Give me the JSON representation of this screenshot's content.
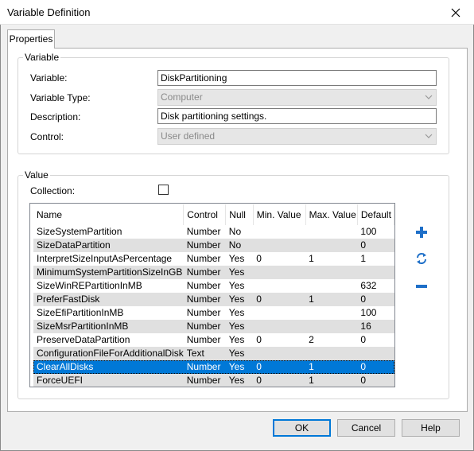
{
  "window": {
    "title": "Variable Definition"
  },
  "tabs": [
    {
      "label": "Properties"
    }
  ],
  "variable_group": {
    "label": "Variable",
    "variable_label": "Variable:",
    "variable_value": "DiskPartitioning",
    "type_label": "Variable Type:",
    "type_value": "Computer",
    "description_label": "Description:",
    "description_value": "Disk partitioning settings.",
    "control_label": "Control:",
    "control_value": "User defined"
  },
  "value_group": {
    "label": "Value",
    "collection_label": "Collection:",
    "collection_checked": false
  },
  "table": {
    "columns": [
      "Name",
      "Control",
      "Null",
      "Min. Value",
      "Max. Value",
      "Default"
    ],
    "rows": [
      [
        "SizeSystemPartition",
        "Number",
        "No",
        "",
        "",
        "100"
      ],
      [
        "SizeDataPartition",
        "Number",
        "No",
        "",
        "",
        "0"
      ],
      [
        "InterpretSizeInputAsPercentage",
        "Number",
        "Yes",
        "0",
        "1",
        "1"
      ],
      [
        "MinimumSystemPartitionSizeInGB",
        "Number",
        "Yes",
        "",
        "",
        ""
      ],
      [
        "SizeWinREPartitionInMB",
        "Number",
        "Yes",
        "",
        "",
        "632"
      ],
      [
        "PreferFastDisk",
        "Number",
        "Yes",
        "0",
        "1",
        "0"
      ],
      [
        "SizeEfiPartitionInMB",
        "Number",
        "Yes",
        "",
        "",
        "100"
      ],
      [
        "SizeMsrPartitionInMB",
        "Number",
        "Yes",
        "",
        "",
        "16"
      ],
      [
        "PreserveDataPartition",
        "Number",
        "Yes",
        "0",
        "2",
        "0"
      ],
      [
        "ConfigurationFileForAdditionalDisk",
        "Text",
        "Yes",
        "",
        "",
        ""
      ],
      [
        "ClearAllDisks",
        "Number",
        "Yes",
        "0",
        "1",
        "0"
      ],
      [
        "ForceUEFI",
        "Number",
        "Yes",
        "0",
        "1",
        "0"
      ]
    ],
    "selected_row": 10
  },
  "side_icons": [
    "add-icon",
    "refresh-icon",
    "remove-icon"
  ],
  "buttons": {
    "ok": "OK",
    "cancel": "Cancel",
    "help": "Help"
  },
  "colors": {
    "accent": "#0078d7",
    "icon_blue": "#1e6fc8",
    "alt_row": "#e0e0e0"
  }
}
